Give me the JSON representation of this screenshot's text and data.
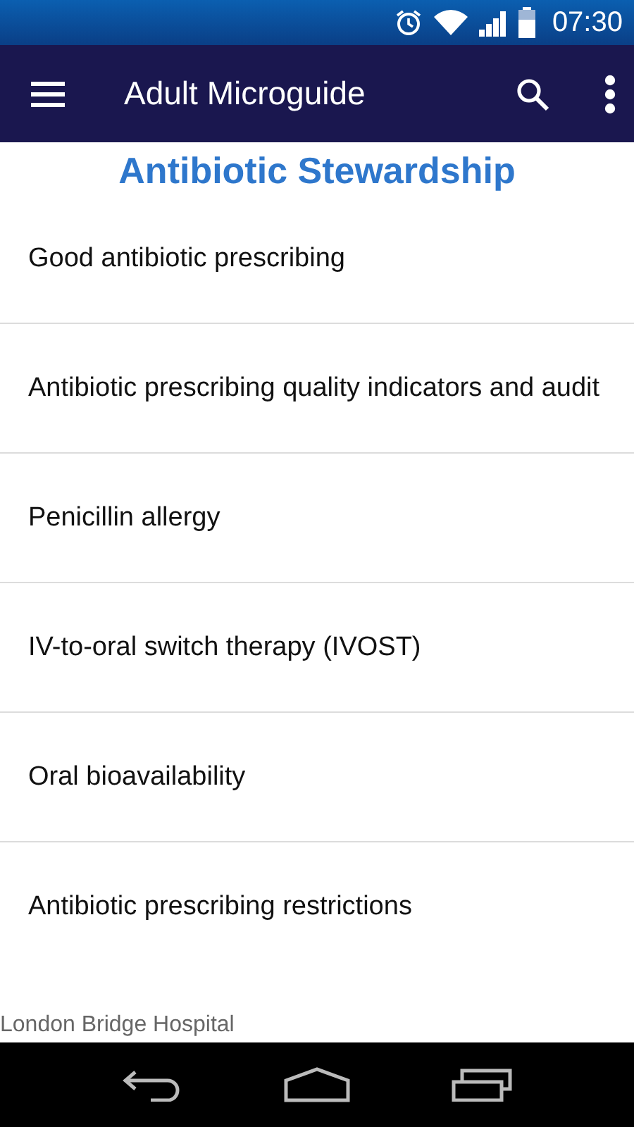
{
  "status_bar": {
    "time": "07:30"
  },
  "app_bar": {
    "title": "Adult Microguide"
  },
  "heading": "Antibiotic Stewardship",
  "items": [
    {
      "label": "Good antibiotic prescribing"
    },
    {
      "label": "Antibiotic prescribing quality indicators and audit"
    },
    {
      "label": "Penicillin allergy"
    },
    {
      "label": "IV-to-oral switch therapy (IVOST)"
    },
    {
      "label": "Oral bioavailability"
    },
    {
      "label": "Antibiotic prescribing restrictions"
    }
  ],
  "footer": "London Bridge Hospital"
}
